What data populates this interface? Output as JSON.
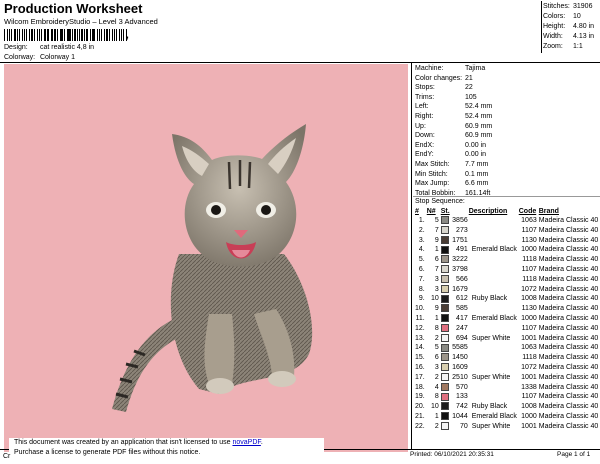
{
  "header": {
    "title": "Production Worksheet",
    "subtitle": "Wilcom EmbroideryStudio – Level 3 Advanced",
    "design_label": "Design:",
    "design_value": "cat realistic 4,8 in",
    "colorway_label": "Colorway:",
    "colorway_value": "Colorway 1"
  },
  "stats": [
    {
      "k": "Stitches:",
      "v": "31906"
    },
    {
      "k": "Colors:",
      "v": "10"
    },
    {
      "k": "Height:",
      "v": "4.80 in"
    },
    {
      "k": "Width:",
      "v": "4.13 in"
    },
    {
      "k": "Zoom:",
      "v": "1:1"
    }
  ],
  "machine": [
    {
      "k": "Machine:",
      "v": "Tajima"
    },
    {
      "k": "Color changes:",
      "v": "21"
    },
    {
      "k": "Stops:",
      "v": "22"
    },
    {
      "k": "Trims:",
      "v": "105"
    },
    {
      "k": "Left:",
      "v": "52.4 mm"
    },
    {
      "k": "Right:",
      "v": "52.4 mm"
    },
    {
      "k": "Up:",
      "v": "60.9 mm"
    },
    {
      "k": "Down:",
      "v": "60.9 mm"
    },
    {
      "k": "EndX:",
      "v": "0.00 in"
    },
    {
      "k": "EndY:",
      "v": "0.00 in"
    },
    {
      "k": "Max Stitch:",
      "v": "7.7 mm"
    },
    {
      "k": "Min Stitch:",
      "v": "0.1 mm"
    },
    {
      "k": "Max Jump:",
      "v": "6.6 mm"
    },
    {
      "k": "Total Bobbin:",
      "v": "161.14ft"
    }
  ],
  "sequence": {
    "title": "Stop Sequence:",
    "headers": [
      "#",
      "N#",
      "St.",
      "Description",
      "Code",
      "Brand"
    ],
    "rows": [
      {
        "i": "1.",
        "n": "5",
        "color": "#8a8a84",
        "st": "3856",
        "desc": "",
        "code": "1063",
        "brand": "Madeira Classic 40"
      },
      {
        "i": "2.",
        "n": "7",
        "color": "#d9d7ce",
        "st": "273",
        "desc": "",
        "code": "1107",
        "brand": "Madeira Classic 40"
      },
      {
        "i": "3.",
        "n": "9",
        "color": "#4a3d35",
        "st": "1751",
        "desc": "",
        "code": "1130",
        "brand": "Madeira Classic 40"
      },
      {
        "i": "4.",
        "n": "1",
        "color": "#111111",
        "st": "491",
        "desc": "Emerald Black",
        "code": "1000",
        "brand": "Madeira Classic 40"
      },
      {
        "i": "5.",
        "n": "6",
        "color": "#9c958a",
        "st": "3222",
        "desc": "",
        "code": "1118",
        "brand": "Madeira Classic 40"
      },
      {
        "i": "6.",
        "n": "7",
        "color": "#d9d7ce",
        "st": "3798",
        "desc": "",
        "code": "1107",
        "brand": "Madeira Classic 40"
      },
      {
        "i": "7.",
        "n": "3",
        "color": "#c8c0b0",
        "st": "566",
        "desc": "",
        "code": "1118",
        "brand": "Madeira Classic 40"
      },
      {
        "i": "8.",
        "n": "3",
        "color": "#d8cfb0",
        "st": "1679",
        "desc": "",
        "code": "1072",
        "brand": "Madeira Classic 40"
      },
      {
        "i": "9.",
        "n": "10",
        "color": "#1a1a1a",
        "st": "612",
        "desc": "Ruby Black",
        "code": "1008",
        "brand": "Madeira Classic 40"
      },
      {
        "i": "10.",
        "n": "9",
        "color": "#4a3d35",
        "st": "585",
        "desc": "",
        "code": "1130",
        "brand": "Madeira Classic 40"
      },
      {
        "i": "11.",
        "n": "1",
        "color": "#111111",
        "st": "417",
        "desc": "Emerald Black",
        "code": "1000",
        "brand": "Madeira Classic 40"
      },
      {
        "i": "12.",
        "n": "8",
        "color": "#e07080",
        "st": "247",
        "desc": "",
        "code": "1107",
        "brand": "Madeira Classic 40"
      },
      {
        "i": "13.",
        "n": "2",
        "color": "#f4f4f4",
        "st": "694",
        "desc": "Super White",
        "code": "1001",
        "brand": "Madeira Classic 40"
      },
      {
        "i": "14.",
        "n": "5",
        "color": "#8a8a84",
        "st": "5585",
        "desc": "",
        "code": "1063",
        "brand": "Madeira Classic 40"
      },
      {
        "i": "15.",
        "n": "6",
        "color": "#9c958a",
        "st": "1450",
        "desc": "",
        "code": "1118",
        "brand": "Madeira Classic 40"
      },
      {
        "i": "16.",
        "n": "3",
        "color": "#d8cfb0",
        "st": "1609",
        "desc": "",
        "code": "1072",
        "brand": "Madeira Classic 40"
      },
      {
        "i": "17.",
        "n": "2",
        "color": "#f4f4f4",
        "st": "2510",
        "desc": "Super White",
        "code": "1001",
        "brand": "Madeira Classic 40"
      },
      {
        "i": "18.",
        "n": "4",
        "color": "#a07860",
        "st": "570",
        "desc": "",
        "code": "1338",
        "brand": "Madeira Classic 40"
      },
      {
        "i": "19.",
        "n": "8",
        "color": "#e07080",
        "st": "133",
        "desc": "",
        "code": "1107",
        "brand": "Madeira Classic 40"
      },
      {
        "i": "20.",
        "n": "10",
        "color": "#1a1a1a",
        "st": "742",
        "desc": "Ruby Black",
        "code": "1008",
        "brand": "Madeira Classic 40"
      },
      {
        "i": "21.",
        "n": "1",
        "color": "#111111",
        "st": "1044",
        "desc": "Emerald Black",
        "code": "1000",
        "brand": "Madeira Classic 40"
      },
      {
        "i": "22.",
        "n": "2",
        "color": "#f4f4f4",
        "st": "70",
        "desc": "Super White",
        "code": "1001",
        "brand": "Madeira Classic 40"
      }
    ]
  },
  "footer": {
    "notice_line1": "This document was created by an application that isn't licensed to use ",
    "notice_link": "novaPDF",
    "notice_line1_end": ".",
    "notice_line2": "Purchase a license to generate PDF files without this notice.",
    "cr": "Cr",
    "printed": "Printed: 06/10/2021 20:35:31",
    "page": "Page 1 of 1"
  },
  "colors": {
    "design_bg": "#eeb1b5",
    "link": "#0000cc"
  }
}
